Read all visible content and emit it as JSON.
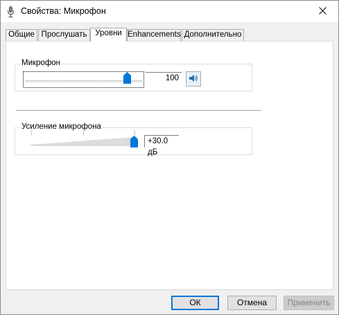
{
  "window": {
    "title": "Свойства: Микрофон",
    "title_icon": "microphone-icon",
    "close_icon": "close-icon"
  },
  "tabs": [
    {
      "label": "Общие",
      "active": false
    },
    {
      "label": "Прослушать",
      "active": false
    },
    {
      "label": "Уровни",
      "active": true
    },
    {
      "label": "Enhancements",
      "active": false
    },
    {
      "label": "Дополнительно",
      "active": false
    }
  ],
  "levels": {
    "microphone": {
      "label": "Микрофон",
      "value": "100",
      "level": 1.0,
      "mute_icon": "speaker-icon"
    },
    "boost": {
      "label": "Усиление микрофона",
      "value": "+30.0 дБ",
      "level": 1.0
    }
  },
  "buttons": {
    "ok": "ОК",
    "cancel": "Отмена",
    "apply": "Применить"
  },
  "colors": {
    "thumb": "#0078d7",
    "default_button_border": "#0078d7"
  }
}
